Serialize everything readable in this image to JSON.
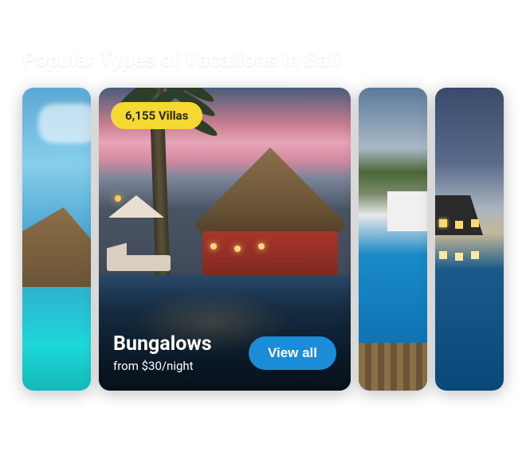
{
  "section": {
    "title": "Popular Types of Vacations in Bali"
  },
  "featuredCard": {
    "badge": "6,155 Villas",
    "title": "Bungalows",
    "priceText": "from $30/night",
    "buttonLabel": "View all"
  }
}
